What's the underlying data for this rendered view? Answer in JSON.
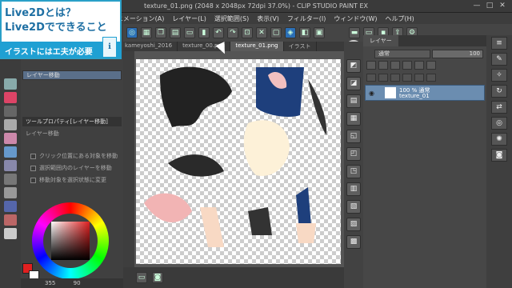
{
  "window": {
    "title": "texture_01.png (2048 x 2048px 72dpi 37.0%) - CLIP STUDIO PAINT EX",
    "minimize": "—",
    "maximize": "□",
    "close": "✕"
  },
  "menu": [
    "アニメーション(A)",
    "レイヤー(L)",
    "選択範囲(S)",
    "表示(V)",
    "フィルター(I)",
    "ウィンドウ(W)",
    "ヘルプ(H)"
  ],
  "tabs": [
    "kameyoshi_2016",
    "texture_00.png",
    "texture_01.png",
    "イラスト"
  ],
  "active_tab": 2,
  "overlay": {
    "line1": "Live2Dとは？",
    "line2": "Live2Dでできること",
    "subtitle": "イラストにはエ夫が必要"
  },
  "left_panel": {
    "layer_move_label": "レイヤー移動",
    "subtool_title": "ツールプロパティ[レイヤー移動]",
    "section_title": "レイヤー移動",
    "options": [
      "クリック位置にある対象を移動",
      "選択範囲内のレイヤーを移動",
      "移動対象を選択状態に変更"
    ]
  },
  "status": {
    "zoom_value": "355",
    "zoom_extra": "90"
  },
  "layer_panel": {
    "tab_label": "レイヤー",
    "blend_mode": "通常",
    "opacity": "100",
    "layer": {
      "line1": "100 % 通常",
      "line2": "texture_01"
    }
  },
  "colors": {
    "accent_blue": "#2aa0c8",
    "layer_selected": "#6b8db0",
    "fg_color": "#e02020",
    "bg_color": "#ffffff"
  }
}
